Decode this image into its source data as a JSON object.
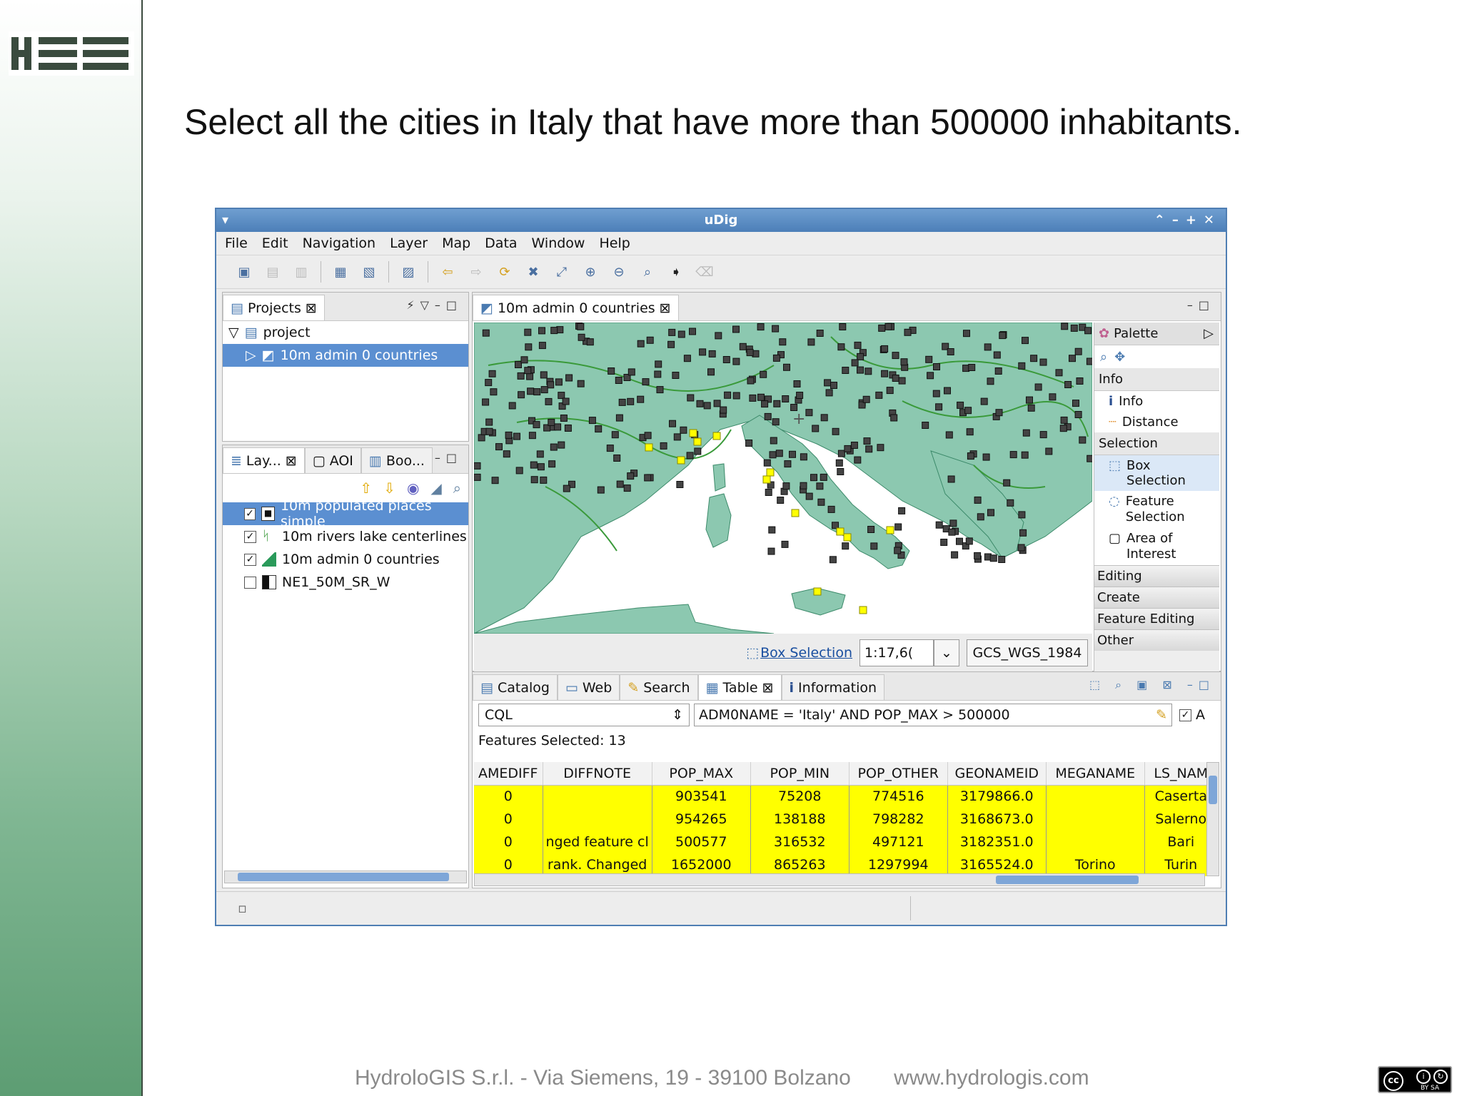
{
  "slide": {
    "title": "Select all the cities in Italy that have more than 500000 inhabitants.",
    "footer_address": "HydroloGIS S.r.l. - Via Siemens, 19 - 39100 Bolzano",
    "footer_web": "www.hydrologis.com"
  },
  "window": {
    "title": "uDig",
    "menu": [
      "File",
      "Edit",
      "Navigation",
      "Layer",
      "Map",
      "Data",
      "Window",
      "Help"
    ]
  },
  "projects": {
    "tab_label": "Projects",
    "root": "project",
    "map_item": "10m admin 0 countries"
  },
  "layers": {
    "tabs": [
      "Lay...",
      "AOI",
      "Boo..."
    ],
    "items": [
      {
        "label": "10m populated places simple",
        "checked": true
      },
      {
        "label": "10m rivers lake centerlines",
        "checked": true
      },
      {
        "label": "10m admin 0 countries",
        "checked": true
      },
      {
        "label": "NE1_50M_SR_W",
        "checked": false
      }
    ]
  },
  "map_editor": {
    "tab_label": "10m admin 0 countries",
    "tool_label": "Box Selection",
    "scale": "1:17,6(",
    "crs": "GCS_WGS_1984",
    "land_color": "#8cc8b0",
    "selected_color": "#ffff00"
  },
  "palette": {
    "header": "Palette",
    "sections": {
      "info": "Info",
      "selection": "Selection",
      "editing": "Editing",
      "create": "Create",
      "feature_editing": "Feature Editing",
      "other": "Other"
    },
    "info_items": [
      "Info",
      "Distance"
    ],
    "selection_items": [
      "Box Selection",
      "Feature Selection",
      "Area of Interest"
    ]
  },
  "bottom": {
    "tabs": [
      "Catalog",
      "Web",
      "Search",
      "Table",
      "Information"
    ],
    "filter_type": "CQL",
    "filter_expression": "ADM0NAME = 'Italy' AND POP_MAX > 500000",
    "checkbox_label": "A",
    "features_selected": "Features Selected: 13",
    "columns": [
      "AMEDIFF",
      "DIFFNOTE",
      "POP_MAX",
      "POP_MIN",
      "POP_OTHER",
      "GEONAMEID",
      "MEGANAME",
      "LS_NAM"
    ],
    "rows": [
      [
        "0",
        "",
        "903541",
        "75208",
        "774516",
        "3179866.0",
        "",
        "Caserta"
      ],
      [
        "0",
        "",
        "954265",
        "138188",
        "798282",
        "3168673.0",
        "",
        "Salerno"
      ],
      [
        "0",
        "nged feature cl",
        "500577",
        "316532",
        "497121",
        "3182351.0",
        "",
        "Bari"
      ],
      [
        "0",
        "rank. Changed",
        "1652000",
        "865263",
        "1297994",
        "3165524.0",
        "Torino",
        "Turin"
      ]
    ]
  }
}
